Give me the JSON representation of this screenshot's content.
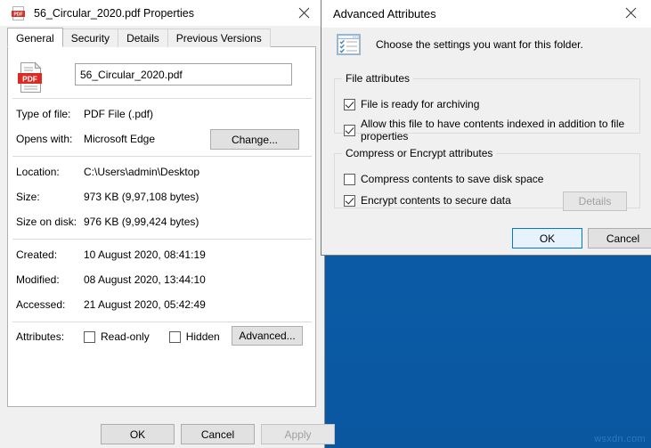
{
  "desktop": {
    "background_color": "#0a5ca8",
    "watermark": "wsxdn.com"
  },
  "properties_window": {
    "title": "56_Circular_2020.pdf Properties",
    "title_icon": "pdf-file-icon",
    "close_icon": "close-icon",
    "tabs": [
      {
        "label": "General",
        "active": true
      },
      {
        "label": "Security",
        "active": false
      },
      {
        "label": "Details",
        "active": false
      },
      {
        "label": "Previous Versions",
        "active": false
      }
    ],
    "file_icon": "pdf-file-icon",
    "file_icon_text": "PDF",
    "filename": "56_Circular_2020.pdf",
    "fields": [
      {
        "label": "Type of file:",
        "value": "PDF File (.pdf)"
      },
      {
        "label": "Opens with:",
        "value": "Microsoft Edge"
      },
      {
        "label": "Location:",
        "value": "C:\\Users\\admin\\Desktop"
      },
      {
        "label": "Size:",
        "value": "973 KB (9,97,108 bytes)"
      },
      {
        "label": "Size on disk:",
        "value": "976 KB (9,99,424 bytes)"
      },
      {
        "label": "Created:",
        "value": "10 August 2020, 08:41:19"
      },
      {
        "label": "Modified:",
        "value": "08 August 2020, 13:44:10"
      },
      {
        "label": "Accessed:",
        "value": "21 August 2020, 05:42:49"
      }
    ],
    "change_button": "Change...",
    "attributes_label": "Attributes:",
    "attributes": [
      {
        "label": "Read-only",
        "checked": false
      },
      {
        "label": "Hidden",
        "checked": false
      }
    ],
    "advanced_button": "Advanced...",
    "footer_buttons": [
      {
        "label": "OK",
        "disabled": false
      },
      {
        "label": "Cancel",
        "disabled": false
      },
      {
        "label": "Apply",
        "disabled": true
      }
    ]
  },
  "advanced_dialog": {
    "title": "Advanced Attributes",
    "close_icon": "close-icon",
    "header_icon": "settings-list-icon",
    "header_text": "Choose the settings you want for this folder.",
    "file_attributes": {
      "legend": "File attributes",
      "items": [
        {
          "label": "File is ready for archiving",
          "checked": true
        },
        {
          "label": "Allow this file to have contents indexed in addition to file properties",
          "checked": true
        }
      ]
    },
    "compress_encrypt": {
      "legend": "Compress or Encrypt attributes",
      "items": [
        {
          "label": "Compress contents to save disk space",
          "checked": false
        },
        {
          "label": "Encrypt contents to secure data",
          "checked": true
        }
      ],
      "details_button": {
        "label": "Details",
        "disabled": true
      }
    },
    "buttons": [
      {
        "label": "OK",
        "default": true
      },
      {
        "label": "Cancel",
        "default": false
      }
    ]
  }
}
